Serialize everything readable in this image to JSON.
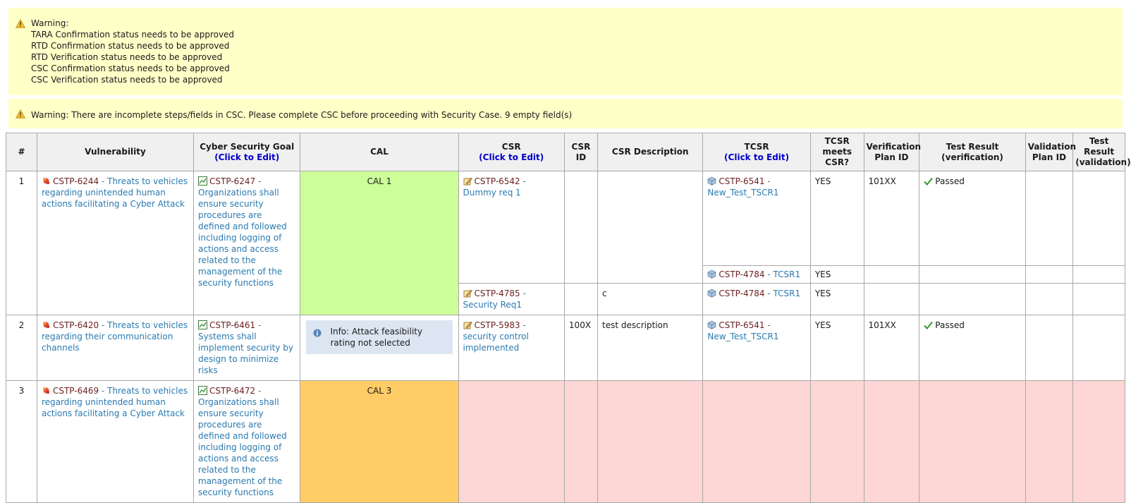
{
  "warnings": {
    "box1": {
      "title": "Warning:",
      "lines": [
        "TARA Confirmation status needs to be approved",
        "RTD Confirmation status needs to be approved",
        "RTD Verification status needs to be approved",
        "CSC Confirmation status needs to be approved",
        "CSC Verification status needs to be approved"
      ]
    },
    "box2": {
      "text": "Warning: There are incomplete steps/fields in CSC. Please complete CSC before proceeding with Security Case. 9 empty field(s)"
    }
  },
  "table": {
    "headers": {
      "num": "#",
      "vulnerability": "Vulnerability",
      "goal": "Cyber Security Goal",
      "goal_edit": "(Click to Edit)",
      "cal": "CAL",
      "csr": "CSR",
      "csr_edit": "(Click to Edit)",
      "csr_id": "CSR ID",
      "csr_desc": "CSR Description",
      "tcsr": "TCSR",
      "tcsr_edit": "(Click to Edit)",
      "tcsr_meets": "TCSR meets CSR?",
      "ver_plan": "Verification Plan ID",
      "test_ver": "Test Result (verification)",
      "val_plan": "Validation Plan ID",
      "test_val": "Test Result (validation)"
    },
    "rows": [
      {
        "num": "1",
        "vuln_id": "CSTP-6244",
        "vuln_text": " - Threats to vehicles regarding unintended human actions facilitating a Cyber Attack",
        "goal_id": "CSTP-6247",
        "goal_text": " - Organizations shall ensure security procedures are defined and followed including logging of actions and access related to the management of the security functions",
        "cal": "CAL 1",
        "csr1_id": "CSTP-6542",
        "csr1_text": " - Dummy req 1",
        "tcsr1a_id": "CSTP-6541",
        "tcsr1a_text": " - New_Test_TSCR1",
        "tcsr1a_meets": "YES",
        "ver_plan": "101XX",
        "test_ver": "Passed",
        "tcsr1b_id": "CSTP-4784",
        "tcsr1b_text": " - TCSR1",
        "tcsr1b_meets": "YES",
        "csr2_id": "CSTP-4785",
        "csr2_text": " - Security Req1",
        "csr2_desc": "c",
        "tcsr2_id": "CSTP-4784",
        "tcsr2_text": " - TCSR1",
        "tcsr2_meets": "YES"
      },
      {
        "num": "2",
        "vuln_id": "CSTP-6420",
        "vuln_text": " - Threats to vehicles regarding their communication channels",
        "goal_id": "CSTP-6461",
        "goal_text": " - Systems shall implement security by design to minimize risks",
        "info": "Info: Attack feasibility rating not selected",
        "csr_id": "CSTP-5983",
        "csr_text": " - security control implemented",
        "csr_num": "100X",
        "csr_desc": "test description",
        "tcsr_id": "CSTP-6541",
        "tcsr_text": " - New_Test_TSCR1",
        "tcsr_meets": "YES",
        "ver_plan": "101XX",
        "test_ver": "Passed"
      },
      {
        "num": "3",
        "vuln_id": "CSTP-6469",
        "vuln_text": " - Threats to vehicles regarding unintended human actions facilitating a Cyber Attack",
        "goal_id": "CSTP-6472",
        "goal_text": " - Organizations shall ensure security procedures are defined and followed including logging of actions and access related to the management of the security functions",
        "cal": "CAL 3"
      }
    ]
  },
  "colors": {
    "warning_bg": "#ffffc8",
    "cal1": "#ccff99",
    "cal3": "#ffcc66",
    "missing": "#ffd6d6",
    "info_bg": "#dbe6f2",
    "link": "#2a7ab0",
    "id_text": "#6b1f1f"
  },
  "icons": {
    "warning": "warning-triangle-icon",
    "vulnerability": "vulnerability-icon",
    "goal": "goal-chart-icon",
    "csr": "requirement-icon",
    "tcsr": "technical-requirement-cube-icon",
    "info": "info-icon",
    "passed": "checkmark-icon"
  }
}
